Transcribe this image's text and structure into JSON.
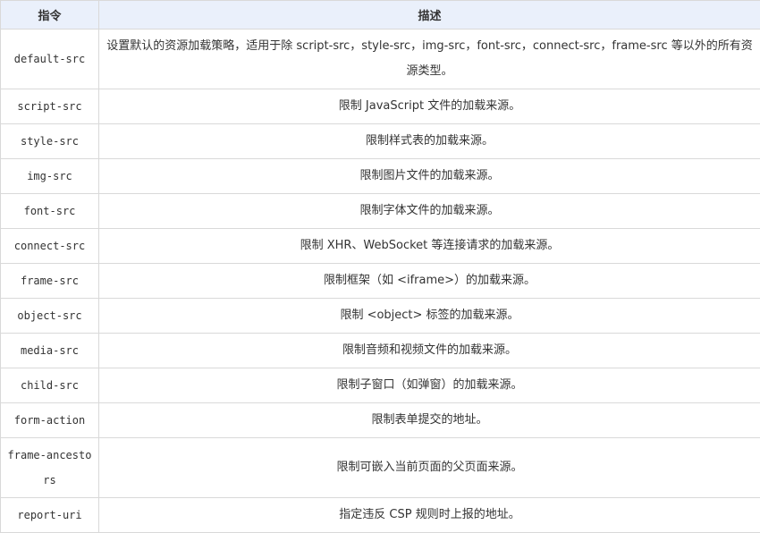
{
  "header": {
    "col1": "指令",
    "col2": "描述"
  },
  "rows": [
    {
      "directive": "default-src",
      "description": "设置默认的资源加载策略，适用于除 script-src，style-src，img-src，font-src，connect-src，frame-src 等以外的所有资源类型。"
    },
    {
      "directive": "script-src",
      "description": "限制 JavaScript 文件的加载来源。"
    },
    {
      "directive": "style-src",
      "description": "限制样式表的加载来源。"
    },
    {
      "directive": "img-src",
      "description": "限制图片文件的加载来源。"
    },
    {
      "directive": "font-src",
      "description": "限制字体文件的加载来源。"
    },
    {
      "directive": "connect-src",
      "description": "限制 XHR、WebSocket 等连接请求的加载来源。"
    },
    {
      "directive": "frame-src",
      "description": "限制框架（如 <iframe>）的加载来源。"
    },
    {
      "directive": "object-src",
      "description": "限制 <object> 标签的加载来源。"
    },
    {
      "directive": "media-src",
      "description": "限制音频和视频文件的加载来源。"
    },
    {
      "directive": "child-src",
      "description": "限制子窗口（如弹窗）的加载来源。"
    },
    {
      "directive": "form-action",
      "description": "限制表单提交的地址。"
    },
    {
      "directive": "frame-ancestors",
      "description": "限制可嵌入当前页面的父页面来源。"
    },
    {
      "directive": "report-uri",
      "description": "指定违反 CSP 规则时上报的地址。"
    }
  ]
}
